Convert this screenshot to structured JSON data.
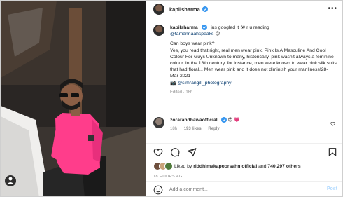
{
  "post": {
    "username": "kapilsharma",
    "verified": true,
    "more_label": "•••"
  },
  "caption": {
    "username": "kapilsharma",
    "intro": "I jus googled it",
    "emoji1": "😮",
    "intro2": "r u reading",
    "mention": "@tamannaahspeaks",
    "emoji2": "😜",
    "heading": "Can boys wear pink?",
    "body": "Yes, you read that right, real men wear pink. Pink Is A Masculine And Cool Colour For Guys Unknown to many, historically, pink wasn't always a feminine colour. In the 18th century, for instance, men were known to wear pink silk suits that had floral... Men wear pink and it does not diminish your manliness!28-Mar-2021",
    "credit_icon": "📷",
    "credit_mention": "@simrangill_photography",
    "meta": "Edited · 18h"
  },
  "comment": {
    "username": "zorarandhawaofficial",
    "emoji1": "😍",
    "emoji2": "💗",
    "time": "18h",
    "likes": "193 likes",
    "reply": "Reply"
  },
  "likes": {
    "prefix": "Liked by",
    "user": "riddhimakapoorsahniofficial",
    "and": "and",
    "count": "740,297 others"
  },
  "timestamp": "18 HOURS AGO",
  "add_comment": {
    "placeholder": "Add a comment...",
    "post_label": "Post"
  },
  "colors": {
    "mention": "#00376b",
    "verified": "#3897f0",
    "post_button": "#b3dbff",
    "shirt": "#ff3d8b"
  },
  "icons": {
    "like": "heart-icon",
    "comment": "comment-icon",
    "share": "share-icon",
    "save": "bookmark-icon",
    "emoji": "emoji-icon"
  }
}
